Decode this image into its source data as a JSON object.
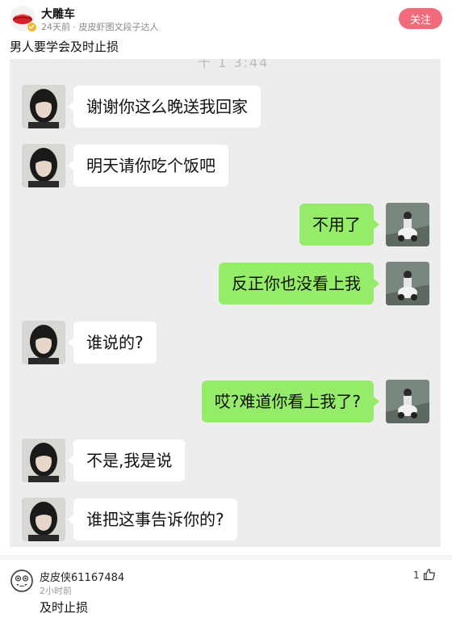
{
  "post": {
    "author": "大雕车",
    "meta": "24天前 · 皮皮虾图文段子达人",
    "follow_label": "关注",
    "text": "男人要学会及时止损"
  },
  "chat": {
    "time_ghost": "十  1 3:44",
    "messages": [
      {
        "side": "left",
        "text": "谢谢你这么晚送我回家"
      },
      {
        "side": "left",
        "text": "明天请你吃个饭吧"
      },
      {
        "side": "right",
        "text": "不用了"
      },
      {
        "side": "right",
        "text": "反正你也没看上我"
      },
      {
        "side": "left",
        "text": "谁说的?"
      },
      {
        "side": "right",
        "text": "哎?难道你看上我了?"
      },
      {
        "side": "left",
        "text": "不是,我是说"
      },
      {
        "side": "left",
        "text": "谁把这事告诉你的?"
      }
    ]
  },
  "comment": {
    "user": "皮皮侠61167484",
    "time": "2小时前",
    "text": "及时止损",
    "likes": "1"
  },
  "colors": {
    "follow": "#f26b7b",
    "bubble_right": "#95ec69",
    "bubble_left": "#ffffff",
    "chat_bg": "#ededed"
  },
  "icons": {
    "verified": "verified-badge-icon",
    "like": "thumbs-up-icon"
  }
}
